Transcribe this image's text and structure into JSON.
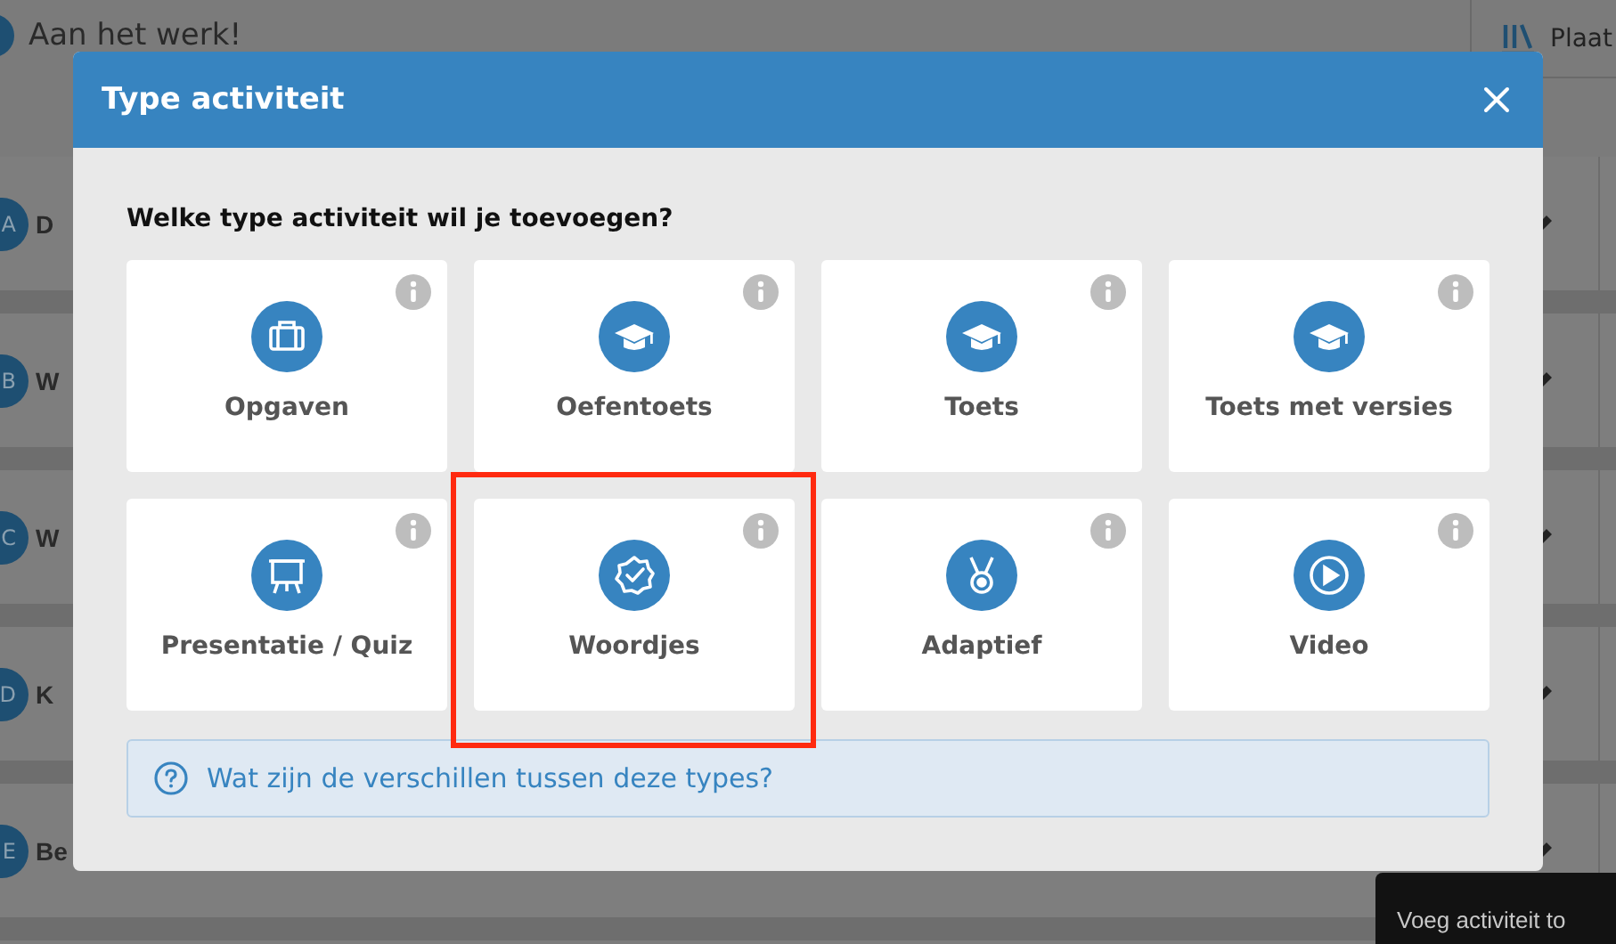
{
  "page": {
    "title": "Aan het werk!",
    "side_label": "Plaat",
    "rows": [
      {
        "badge": "A",
        "text": "D"
      },
      {
        "badge": "B",
        "text": "W"
      },
      {
        "badge": "C",
        "text": "W"
      },
      {
        "badge": "D",
        "text": "K"
      },
      {
        "badge": "E",
        "text": "Be"
      }
    ],
    "tooltip": "Voeg activiteit to"
  },
  "dialog": {
    "title": "Type activiteit",
    "question": "Welke type activiteit wil je toevoegen?",
    "types": [
      {
        "label": "Opgaven",
        "kind": "briefcase",
        "highlighted": false
      },
      {
        "label": "Oefentoets",
        "kind": "cap",
        "highlighted": false
      },
      {
        "label": "Toets",
        "kind": "cap",
        "highlighted": false
      },
      {
        "label": "Toets met versies",
        "kind": "cap",
        "highlighted": false
      },
      {
        "label": "Presentatie / Quiz",
        "kind": "easel",
        "highlighted": false
      },
      {
        "label": "Woordjes",
        "kind": "check-badge",
        "highlighted": true
      },
      {
        "label": "Adaptief",
        "kind": "medal",
        "highlighted": false
      },
      {
        "label": "Video",
        "kind": "play",
        "highlighted": false
      }
    ],
    "help_link": "Wat zijn de verschillen tussen deze types?"
  }
}
